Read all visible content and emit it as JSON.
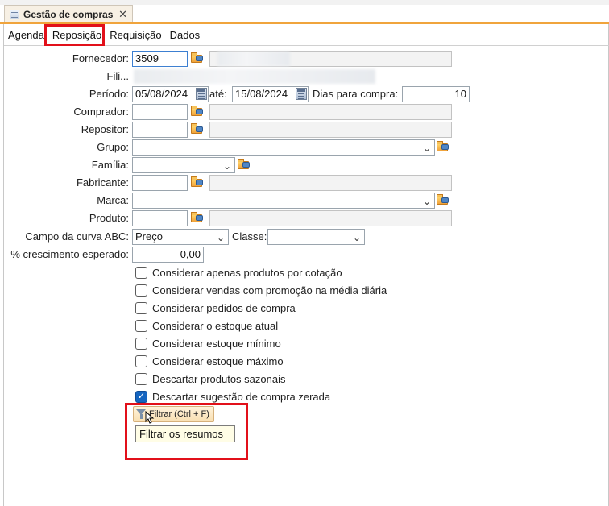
{
  "doc_tab": {
    "title": "Gestão de compras",
    "close": "✕"
  },
  "tabs": [
    "Agenda",
    "Reposição",
    "Requisição",
    "Dados"
  ],
  "form": {
    "fornecedor": {
      "label": "Fornecedor:",
      "value": "3509"
    },
    "filial": {
      "label": "Fili..."
    },
    "periodo": {
      "label": "Período:",
      "start": "05/08/2024",
      "ate_label": "até:",
      "end": "15/08/2024",
      "dias_label": "Dias para compra:",
      "dias_value": "10"
    },
    "comprador": {
      "label": "Comprador:"
    },
    "repositor": {
      "label": "Repositor:"
    },
    "grupo": {
      "label": "Grupo:"
    },
    "familia": {
      "label": "Família:"
    },
    "fabricante": {
      "label": "Fabricante:"
    },
    "marca": {
      "label": "Marca:"
    },
    "produto": {
      "label": "Produto:"
    },
    "curva": {
      "label": "Campo da curva ABC:",
      "value": "Preço",
      "classe_label": "Classe:"
    },
    "crescimento": {
      "label": "% crescimento esperado:",
      "value": "0,00"
    }
  },
  "checkboxes": [
    {
      "label": "Considerar apenas produtos por cotação",
      "checked": false
    },
    {
      "label": "Considerar vendas com promoção na média diária",
      "checked": false
    },
    {
      "label": "Considerar pedidos de compra",
      "checked": false
    },
    {
      "label": "Considerar o estoque atual",
      "checked": false
    },
    {
      "label": "Considerar estoque mínimo",
      "checked": false
    },
    {
      "label": "Considerar estoque máximo",
      "checked": false
    },
    {
      "label": "Descartar produtos sazonais",
      "checked": false
    },
    {
      "label": "Descartar sugestão de compra zerada",
      "checked": true
    }
  ],
  "filter_button": {
    "label": "Filtrar (Ctrl + F)"
  },
  "tooltip": {
    "text": "Filtrar os resumos"
  },
  "colors": {
    "highlight": "#e2101a",
    "accent": "#f0a43c",
    "checkbox_on": "#1565c0"
  }
}
